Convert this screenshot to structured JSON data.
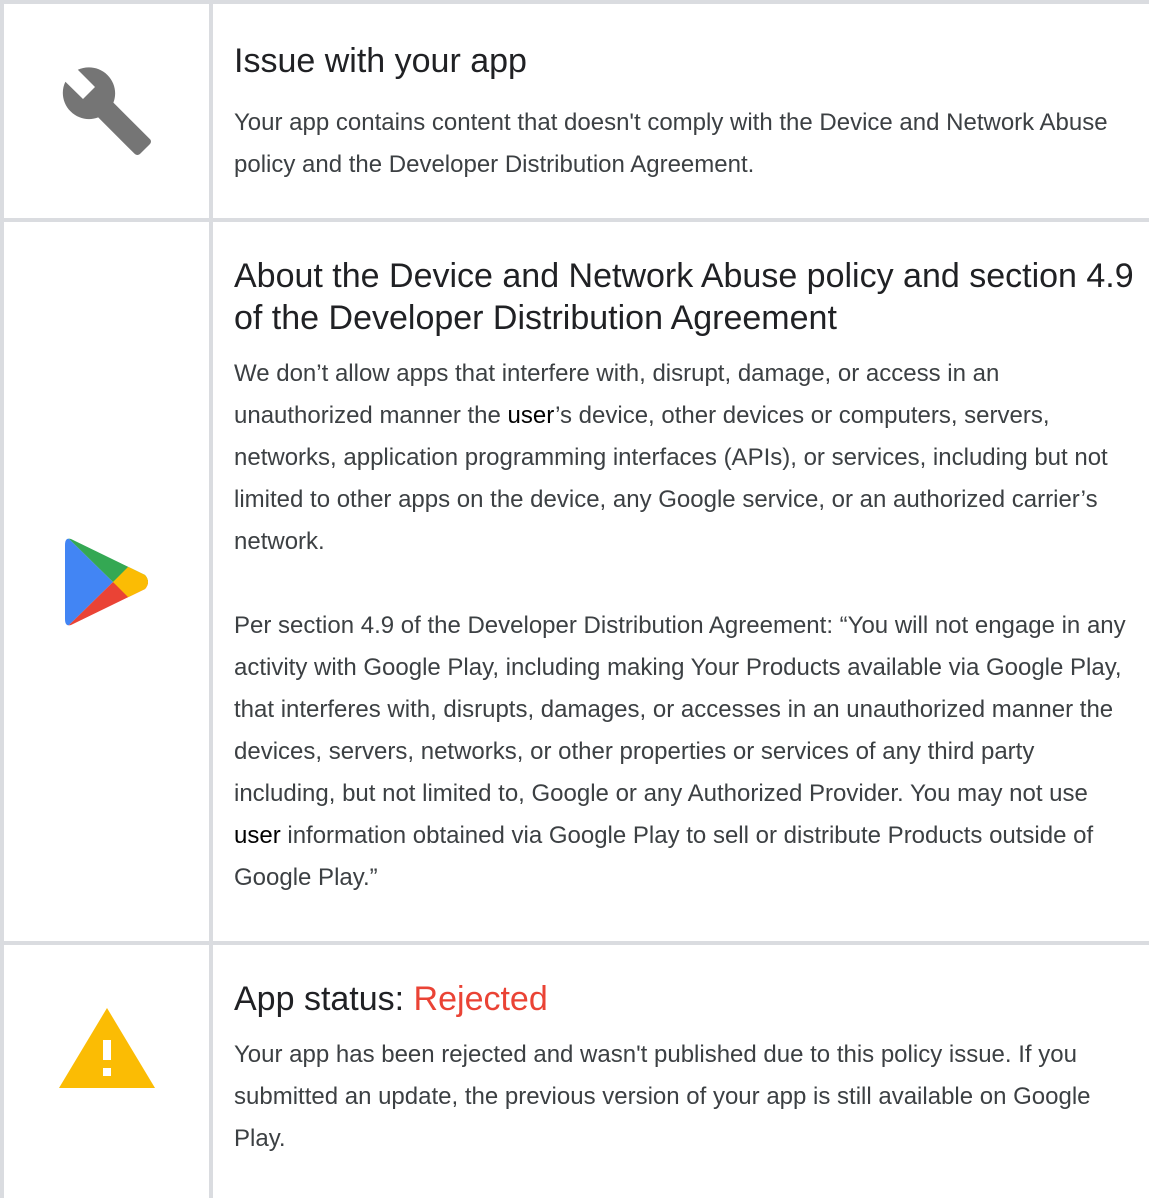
{
  "sections": [
    {
      "icon": "wrench-icon",
      "title": "Issue with your app",
      "body": "Your app contains content that doesn't comply with the Device and Network Abuse policy and the Developer Distribution Agreement."
    },
    {
      "icon": "google-play-icon",
      "title": "About the Device and Network Abuse policy and section 4.9 of the Developer Distribution Agreement",
      "para1": {
        "before": "We don’t allow apps that interfere with, disrupt, damage, or access in an unauthorized manner the ",
        "link": "user",
        "after": "’s device, other devices or computers, servers, networks, application programming interfaces (APIs), or services, including but not limited to other apps on the device, any Google service, or an authorized carrier’s network."
      },
      "para2": {
        "before": "Per section 4.9 of the Developer Distribution Agreement: “You will not engage in any activity with Google Play, including making Your Products available via Google Play, that interferes with, disrupts, damages, or accesses in an unauthorized manner the devices, servers, networks, or other properties or services of any third party including, but not limited to, Google or any Authorized Provider. You may not use ",
        "link": "user",
        "after": " information obtained via Google Play to sell or distribute Products outside of Google Play.”"
      }
    },
    {
      "icon": "warning-icon",
      "title_prefix": "App status: ",
      "status": "Rejected",
      "body": "Your app has been rejected and wasn't published due to this policy issue. If you submitted an update, the previous version of your app is still available on Google Play."
    }
  ],
  "colors": {
    "rejected": "#ea4335",
    "border": "#dadce0",
    "wrench": "#757575",
    "warning": "#fbbc04"
  }
}
